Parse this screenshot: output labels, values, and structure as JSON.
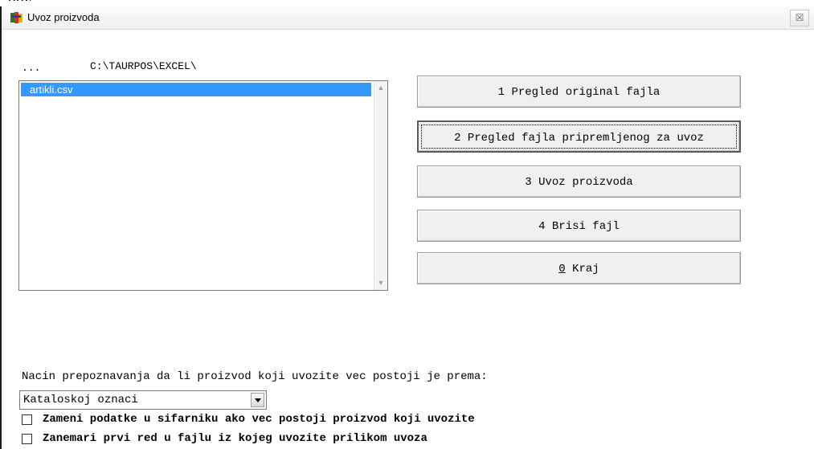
{
  "top_cropped_text": "ggy",
  "window": {
    "title": "Uvoz proizvoda",
    "close_glyph": "☒"
  },
  "file_browser": {
    "browse_label": "...",
    "path": "C:\\TAURPOS\\EXCEL\\",
    "files": [
      "artikli.csv"
    ]
  },
  "actions": {
    "preview_original": {
      "num": "1",
      "text": " Pregled original fajla"
    },
    "preview_prepared": {
      "num": "2",
      "text": " Pregled fajla pripremljenog za uvoz"
    },
    "import": {
      "num": "3",
      "text": " Uvoz proizvoda"
    },
    "delete": {
      "num": "4",
      "text": " Brisi fajl"
    },
    "exit": {
      "num": "0",
      "text": " Kraj"
    }
  },
  "options": {
    "method_label": "Nacin prepoznavanja da li proizvod koji uvozite vec postoji je prema:",
    "method_selected": "Kataloskoj oznaci",
    "replace_data_label": "Zameni podatke u sifarniku ako vec postoji proizvod koji uvozite",
    "replace_data_checked": false,
    "ignore_first_row_label": "Zanemari prvi red u fajlu iz kojeg uvozite prilikom uvoza",
    "ignore_first_row_checked": false
  },
  "colors": {
    "selection": "#3399ff",
    "button_face": "#f0f0f0"
  },
  "icons": {
    "app": "app-icon",
    "close": "close-icon",
    "dropdown": "chevron-down-icon"
  }
}
